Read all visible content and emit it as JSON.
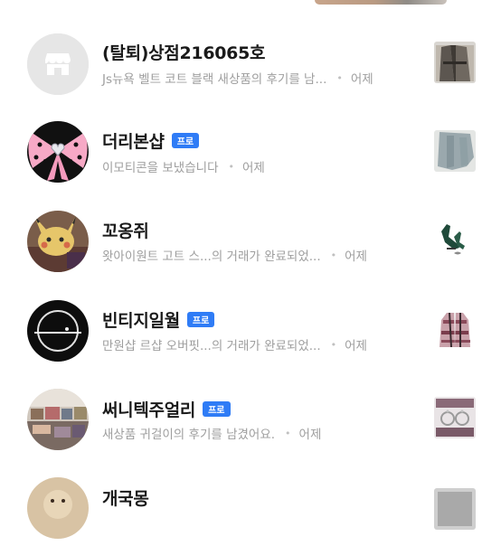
{
  "chats": [
    {
      "name": "(탈퇴)상점216065호",
      "badge": "",
      "message": "Js뉴욕 벨트 코트 블랙 새상품의 후기를 남...",
      "time": "어제",
      "avatar_icon": "store-icon",
      "thumb_icon": "coat-photo"
    },
    {
      "name": "더리본샵",
      "badge": "프로",
      "message": "이모티콘을 보냈습니다",
      "time": "어제",
      "avatar_icon": "pink-ribbon",
      "thumb_icon": "jeans-photo"
    },
    {
      "name": "꼬옹쥐",
      "badge": "",
      "message": "왓아이원트 고트 스...의 거래가 완료되었...",
      "time": "어제",
      "avatar_icon": "pikachu-plush",
      "thumb_icon": "boots-photo"
    },
    {
      "name": "빈티지일월",
      "badge": "프로",
      "message": "만원샵 르샵 오버핏...의 거래가 완료되었...",
      "time": "어제",
      "avatar_icon": "moon-logo",
      "thumb_icon": "check-coat-photo"
    },
    {
      "name": "써니텍주얼리",
      "badge": "프로",
      "message": "새상품 귀걸이의 후기를 남겼어요.",
      "time": "어제",
      "avatar_icon": "shop-photo",
      "thumb_icon": "earrings-photo"
    },
    {
      "name": "개국몽",
      "badge": "",
      "message": "",
      "time": "",
      "avatar_icon": "puppy-photo",
      "thumb_icon": "item-photo"
    }
  ],
  "colors": {
    "badge": "#2f7cf6",
    "name": "#1a1a1a",
    "subtext": "#9e9e9e"
  }
}
